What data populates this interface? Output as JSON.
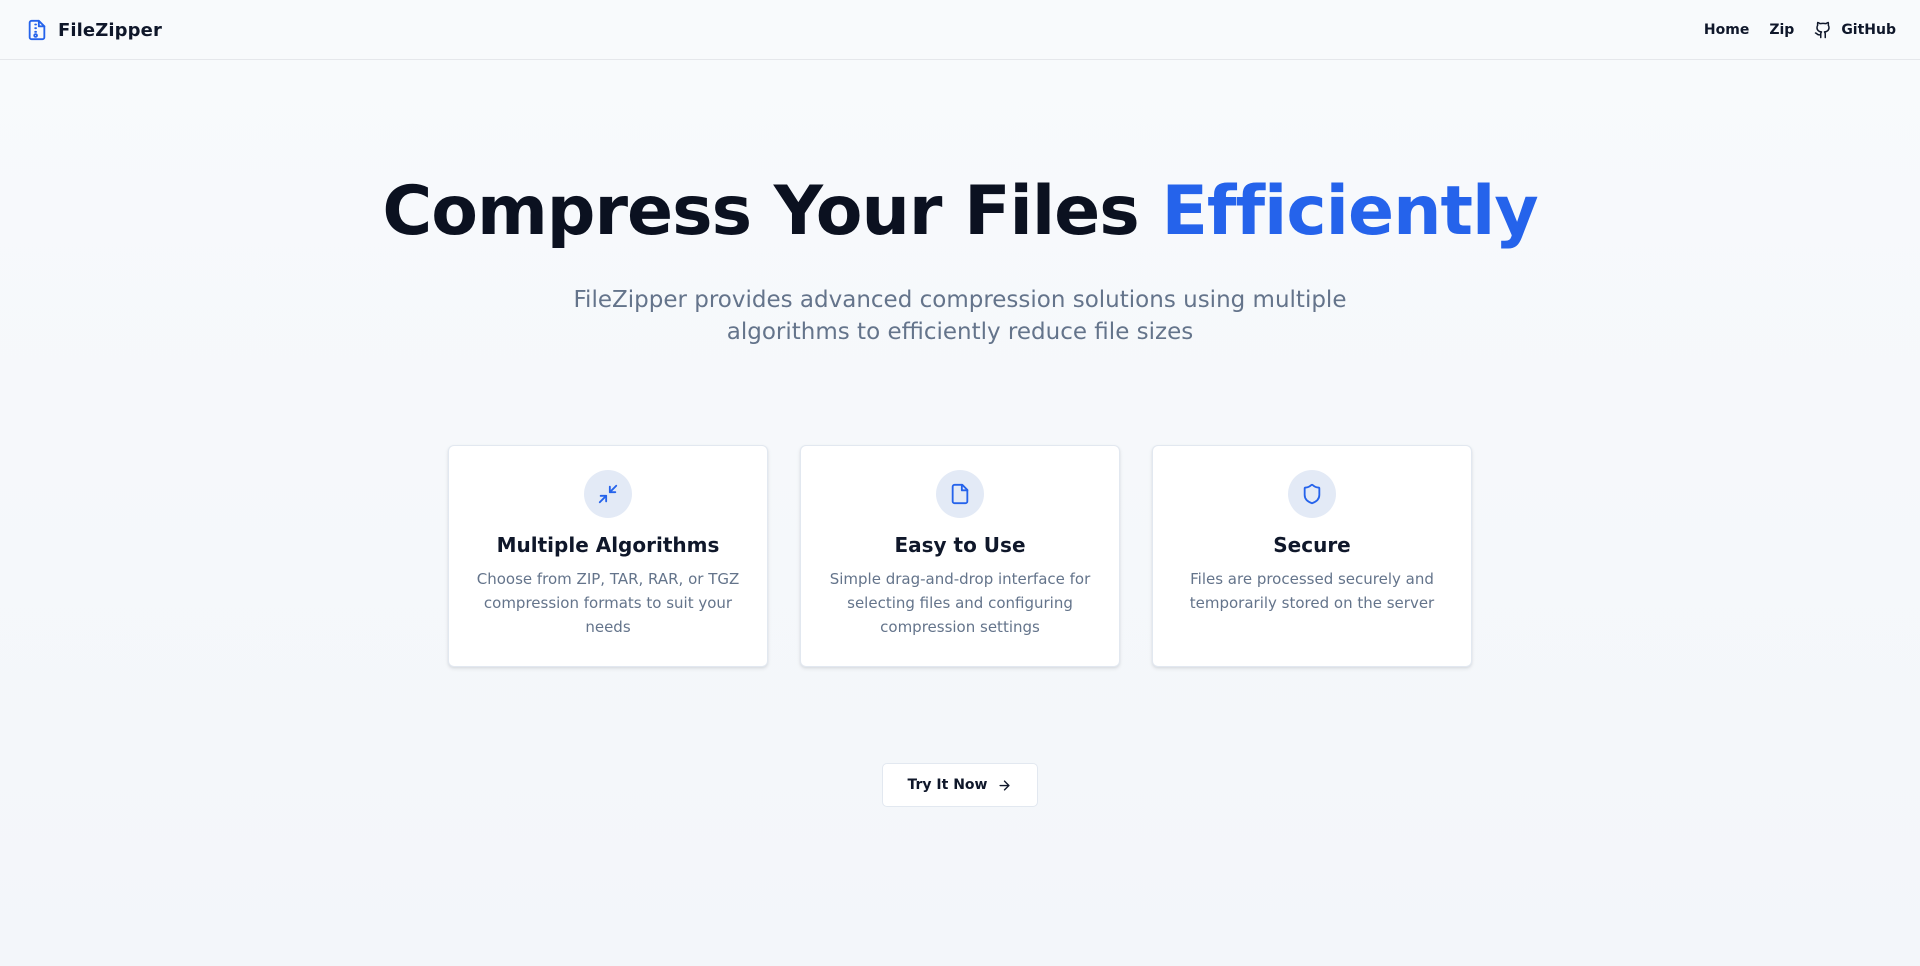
{
  "header": {
    "brand": "FileZipper",
    "brand_icon": "file-archive-icon",
    "nav": [
      {
        "label": "Home"
      },
      {
        "label": "Zip"
      },
      {
        "label": "GitHub",
        "icon": "github-icon"
      }
    ]
  },
  "hero": {
    "title_main": "Compress Your Files ",
    "title_accent": "Efficiently",
    "subtitle": "FileZipper provides advanced compression solutions using multiple algorithms to efficiently reduce file sizes"
  },
  "features": [
    {
      "icon": "minimize-arrows-icon",
      "title": "Multiple Algorithms",
      "description": "Choose from ZIP, TAR, RAR, or TGZ compression formats to suit your needs"
    },
    {
      "icon": "file-icon",
      "title": "Easy to Use",
      "description": "Simple drag-and-drop interface for selecting files and configuring compression settings"
    },
    {
      "icon": "shield-icon",
      "title": "Secure",
      "description": "Files are processed securely and temporarily stored on the server"
    }
  ],
  "cta": {
    "label": "Try It Now",
    "icon": "arrow-right-icon"
  },
  "colors": {
    "accent": "#2563eb",
    "heading": "#0b1120",
    "muted_text": "#64748b",
    "icon_badge_bg": "#e3eaf6",
    "page_bg": "#f8fafc"
  }
}
